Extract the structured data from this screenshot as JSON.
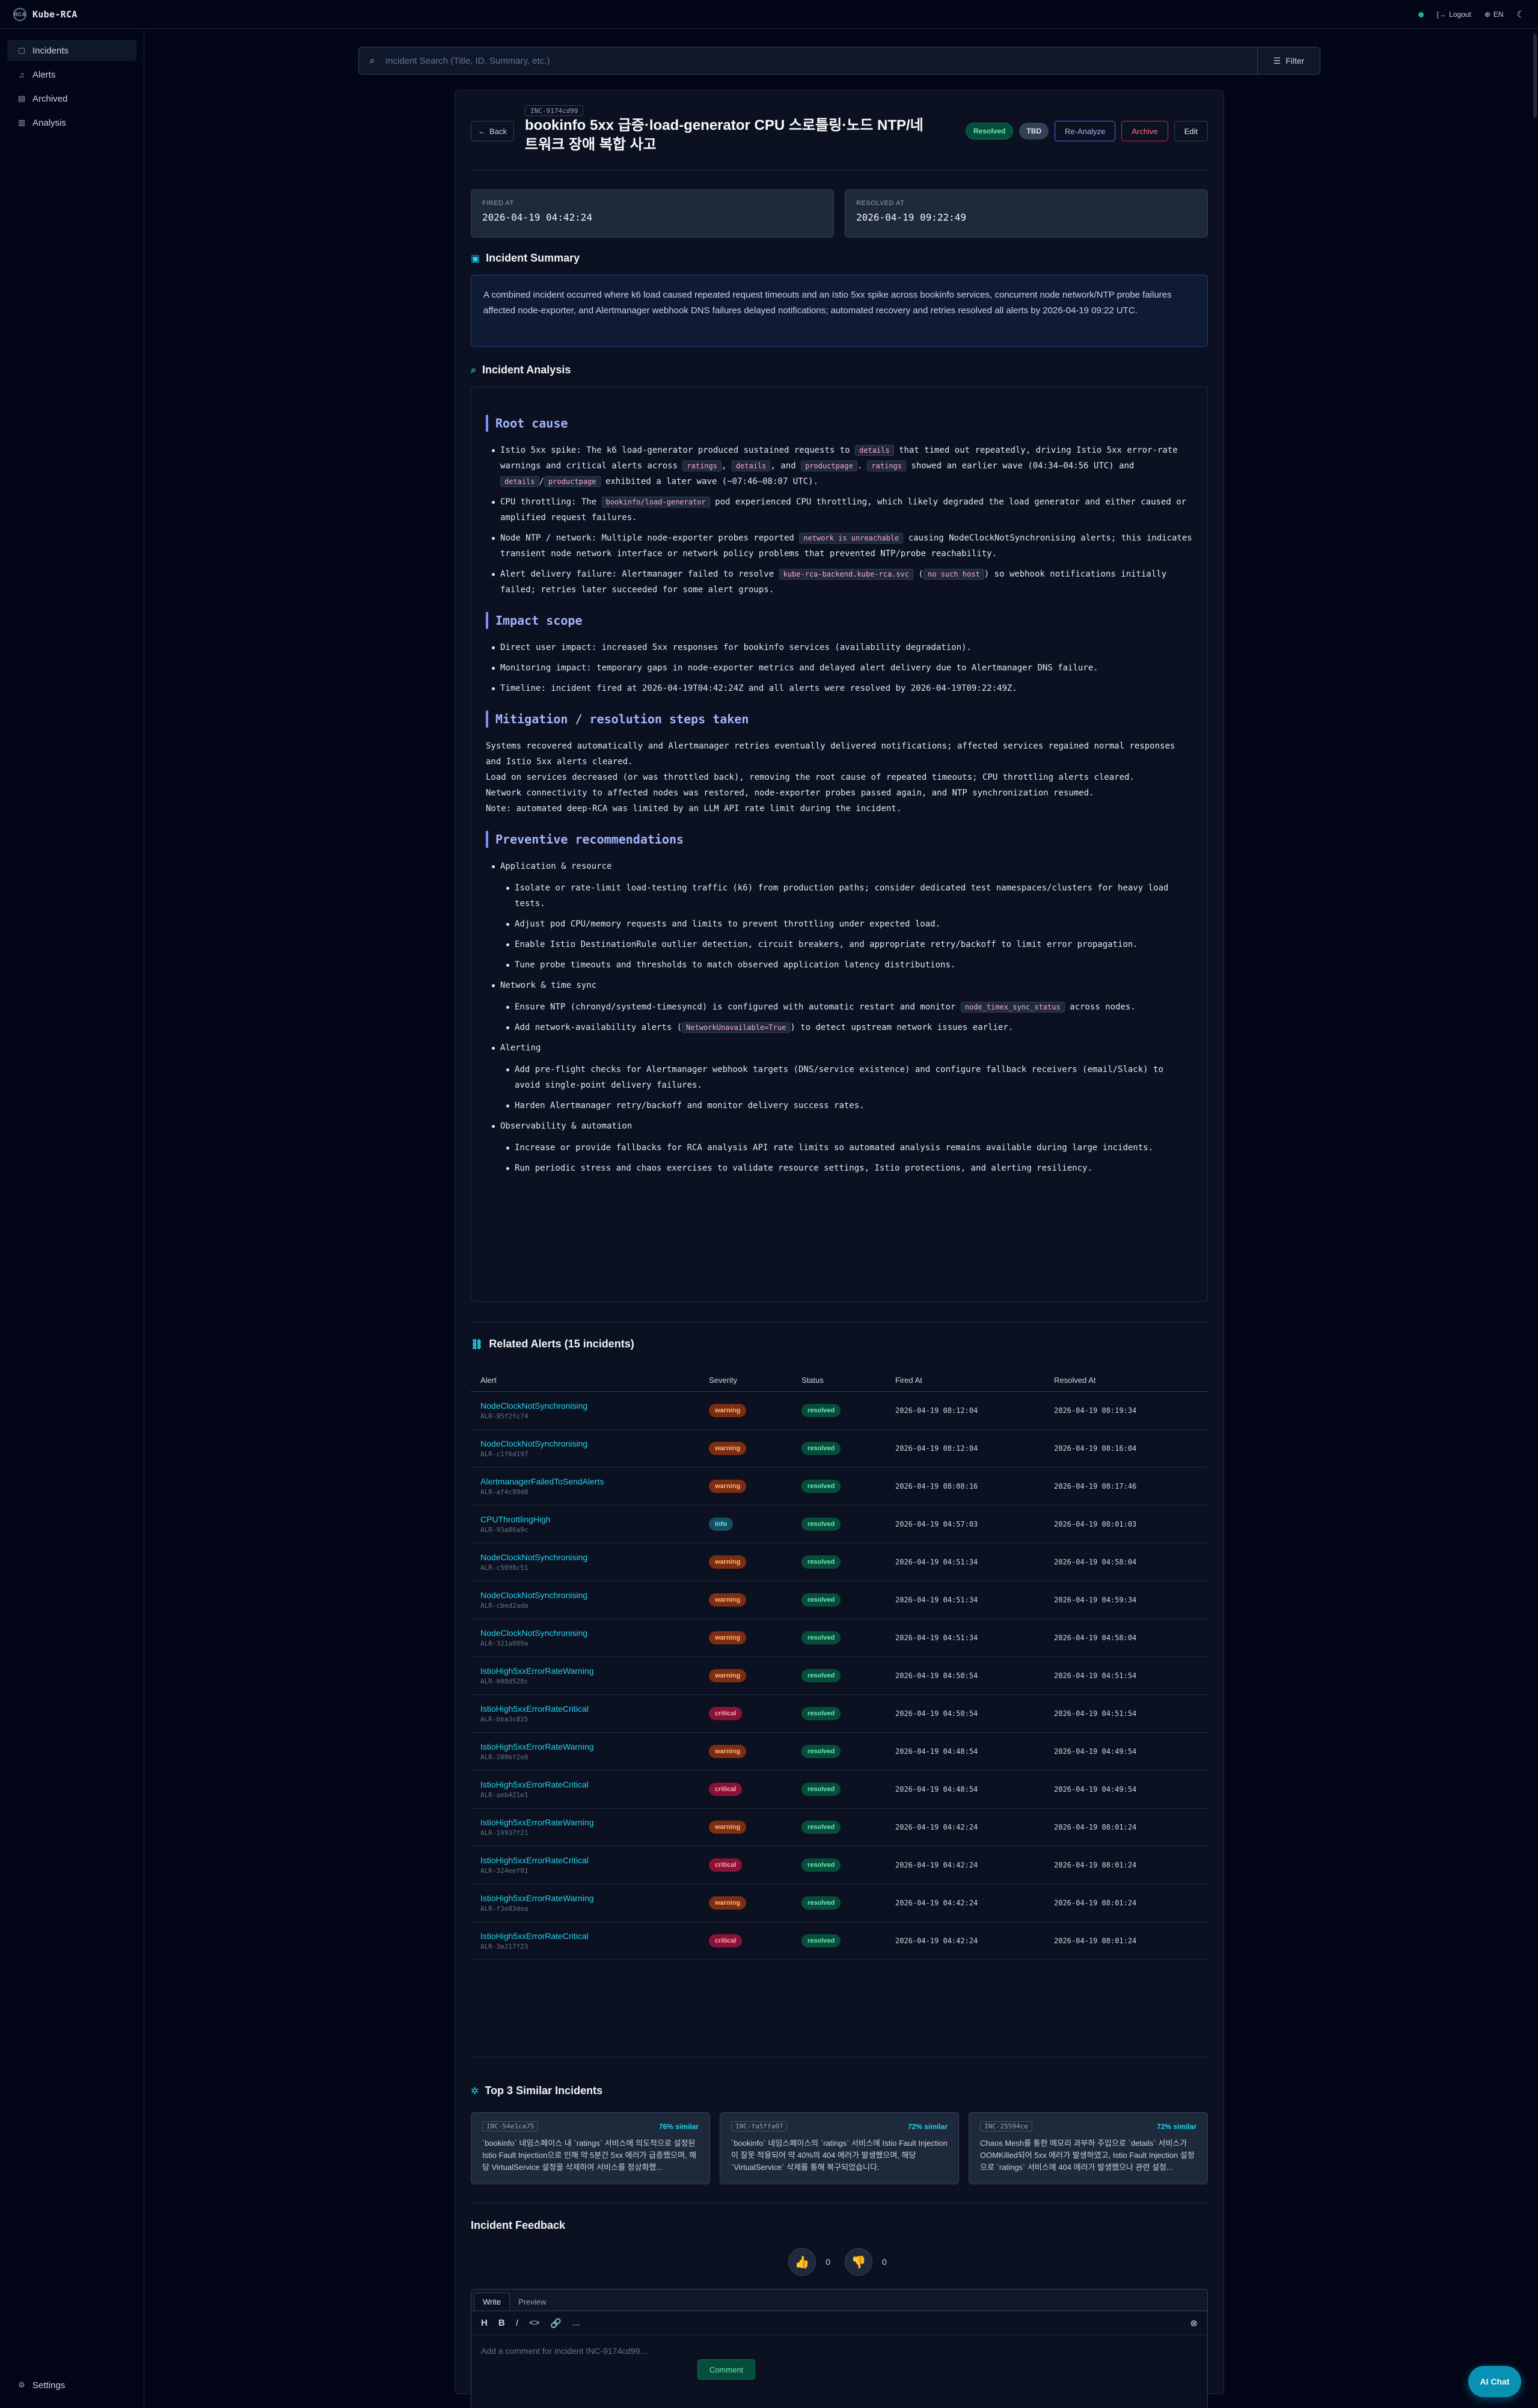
{
  "app": {
    "name": "Kube-RCA",
    "logo_text": "RCA"
  },
  "topbar": {
    "logout": "Logout",
    "lang": "EN"
  },
  "sidebar": {
    "items": [
      {
        "label": "Incidents",
        "icon": "incidents-icon"
      },
      {
        "label": "Alerts",
        "icon": "bell-icon"
      },
      {
        "label": "Archived",
        "icon": "archive-icon"
      },
      {
        "label": "Analysis",
        "icon": "chart-icon"
      }
    ],
    "settings": "Settings"
  },
  "search": {
    "placeholder": "Incident Search (Title, ID, Summary, etc.)",
    "filter_label": "Filter"
  },
  "incident": {
    "id": "INC-9174cd99",
    "back": "Back",
    "title": "bookinfo 5xx 급증·load-generator CPU 스로틀링·노드 NTP/네트워크 장애 복합 사고",
    "status": "Resolved",
    "tag": "TBD",
    "actions": {
      "reanalyze": "Re-Analyze",
      "archive": "Archive",
      "edit": "Edit"
    },
    "fired_label": "FIRED AT",
    "fired_at": "2026-04-19 04:42:24",
    "resolved_label": "RESOLVED AT",
    "resolved_at": "2026-04-19 09:22:49"
  },
  "summary": {
    "heading": "Incident Summary",
    "text": "A combined incident occurred where k6 load caused repeated request timeouts and an Istio 5xx spike across bookinfo services, concurrent node network/NTP probe failures affected node-exporter, and Alertmanager webhook DNS failures delayed notifications; automated recovery and retries resolved all alerts by 2026-04-19 09:22 UTC."
  },
  "analysis": {
    "heading": "Incident Analysis",
    "root_cause": {
      "title": "Root cause",
      "i1": {
        "a": "Istio 5xx spike: The k6 load-generator produced sustained requests to",
        "c1": "details",
        "b": "that timed out repeatedly, driving Istio 5xx error-rate warnings and critical alerts across",
        "c2": "ratings",
        "s1": ",",
        "c3": "details",
        "s2": ", and",
        "c4": "productpage",
        "s3": ".",
        "c5": "ratings",
        "d": "showed an earlier wave (04:34–04:56 UTC) and",
        "c6": "details",
        "s4": "/",
        "c7": "productpage",
        "e": "exhibited a later wave (~07:46–08:07 UTC)."
      },
      "i2": {
        "a": "CPU throttling: The",
        "c1": "bookinfo/load-generator",
        "b": "pod experienced CPU throttling, which likely degraded the load generator and either caused or amplified request failures."
      },
      "i3": {
        "a": "Node NTP / network: Multiple node-exporter probes reported",
        "c1": "network is unreachable",
        "b": "causing NodeClockNotSynchronising alerts; this indicates transient node network interface or network policy problems that prevented NTP/probe reachability."
      },
      "i4": {
        "a": "Alert delivery failure: Alertmanager failed to resolve",
        "c1": "kube-rca-backend.kube-rca.svc",
        "s1": "(",
        "c2": "no such host",
        "b": ") so webhook notifications initially failed; retries later succeeded for some alert groups."
      }
    },
    "impact": {
      "title": "Impact scope",
      "items": [
        "Direct user impact: increased 5xx responses for bookinfo services (availability degradation).",
        "Monitoring impact: temporary gaps in node-exporter metrics and delayed alert delivery due to Alertmanager DNS failure.",
        "Timeline: incident fired at 2026-04-19T04:42:24Z and all alerts were resolved by 2026-04-19T09:22:49Z."
      ]
    },
    "mitigation": {
      "title": "Mitigation / resolution steps taken",
      "lines": [
        "Systems recovered automatically and Alertmanager retries eventually delivered notifications; affected services regained normal responses and Istio 5xx alerts cleared.",
        "Load on services decreased (or was throttled back), removing the root cause of repeated timeouts; CPU throttling alerts cleared.",
        "Network connectivity to affected nodes was restored, node-exporter probes passed again, and NTP synchronization resumed.",
        "Note: automated deep-RCA was limited by an LLM API rate limit during the incident."
      ]
    },
    "preventive": {
      "title": "Preventive recommendations",
      "app": {
        "title": "Application & resource",
        "items": [
          "Isolate or rate-limit load-testing traffic (k6) from production paths; consider dedicated test namespaces/clusters for heavy load tests.",
          "Adjust pod CPU/memory requests and limits to prevent throttling under expected load.",
          "Enable Istio DestinationRule outlier detection, circuit breakers, and appropriate retry/backoff to limit error propagation.",
          "Tune probe timeouts and thresholds to match observed application latency distributions."
        ]
      },
      "net": {
        "title": "Network & time sync",
        "n1": {
          "a": "Ensure NTP (chronyd/systemd-timesyncd) is configured with automatic restart and monitor",
          "c1": "node_timex_sync_status",
          "b": "across nodes."
        },
        "n2": {
          "a": "Add network-availability alerts (",
          "c1": "NetworkUnavailable=True",
          "b": ") to detect upstream network issues earlier."
        }
      },
      "alerting": {
        "title": "Alerting",
        "items": [
          "Add pre-flight checks for Alertmanager webhook targets (DNS/service existence) and configure fallback receivers (email/Slack) to avoid single-point delivery failures.",
          "Harden Alertmanager retry/backoff and monitor delivery success rates."
        ]
      },
      "obs": {
        "title": "Observability & automation",
        "items": [
          "Increase or provide fallbacks for RCA analysis API rate limits so automated analysis remains available during large incidents.",
          "Run periodic stress and chaos exercises to validate resource settings, Istio protections, and alerting resiliency."
        ]
      }
    }
  },
  "related": {
    "heading": "Related Alerts (15 incidents)",
    "columns": [
      "Alert",
      "Severity",
      "Status",
      "Fired At",
      "Resolved At"
    ],
    "rows": [
      {
        "name": "NodeClockNotSynchronising",
        "id": "ALR-95f2fc74",
        "severity": "warning",
        "status": "resolved",
        "fired": "2026-04-19 08:12:04",
        "resolved": "2026-04-19 08:19:34"
      },
      {
        "name": "NodeClockNotSynchronising",
        "id": "ALR-c1f6d197",
        "severity": "warning",
        "status": "resolved",
        "fired": "2026-04-19 08:12:04",
        "resolved": "2026-04-19 08:16:04"
      },
      {
        "name": "AlertmanagerFailedToSendAlerts",
        "id": "ALR-af4c89d8",
        "severity": "warning",
        "status": "resolved",
        "fired": "2026-04-19 08:08:16",
        "resolved": "2026-04-19 08:17:46"
      },
      {
        "name": "CPUThrottlingHigh",
        "id": "ALR-93a86a9c",
        "severity": "info",
        "status": "resolved",
        "fired": "2026-04-19 04:57:03",
        "resolved": "2026-04-19 08:01:03"
      },
      {
        "name": "NodeClockNotSynchronising",
        "id": "ALR-c5098c51",
        "severity": "warning",
        "status": "resolved",
        "fired": "2026-04-19 04:51:34",
        "resolved": "2026-04-19 04:58:04"
      },
      {
        "name": "NodeClockNotSynchronising",
        "id": "ALR-cbed2ada",
        "severity": "warning",
        "status": "resolved",
        "fired": "2026-04-19 04:51:34",
        "resolved": "2026-04-19 04:59:34"
      },
      {
        "name": "NodeClockNotSynchronising",
        "id": "ALR-321a809a",
        "severity": "warning",
        "status": "resolved",
        "fired": "2026-04-19 04:51:34",
        "resolved": "2026-04-19 04:58:04"
      },
      {
        "name": "IstioHigh5xxErrorRateWarning",
        "id": "ALR-608d528c",
        "severity": "warning",
        "status": "resolved",
        "fired": "2026-04-19 04:50:54",
        "resolved": "2026-04-19 04:51:54"
      },
      {
        "name": "IstioHigh5xxErrorRateCritical",
        "id": "ALR-bba3c825",
        "severity": "critical",
        "status": "resolved",
        "fired": "2026-04-19 04:50:54",
        "resolved": "2026-04-19 04:51:54"
      },
      {
        "name": "IstioHigh5xxErrorRateWarning",
        "id": "ALR-280bf2e8",
        "severity": "warning",
        "status": "resolved",
        "fired": "2026-04-19 04:48:54",
        "resolved": "2026-04-19 04:49:54"
      },
      {
        "name": "IstioHigh5xxErrorRateCritical",
        "id": "ALR-aeb421e1",
        "severity": "critical",
        "status": "resolved",
        "fired": "2026-04-19 04:48:54",
        "resolved": "2026-04-19 04:49:54"
      },
      {
        "name": "IstioHigh5xxErrorRateWarning",
        "id": "ALR-19937f21",
        "severity": "warning",
        "status": "resolved",
        "fired": "2026-04-19 04:42:24",
        "resolved": "2026-04-19 08:01:24"
      },
      {
        "name": "IstioHigh5xxErrorRateCritical",
        "id": "ALR-324eef01",
        "severity": "critical",
        "status": "resolved",
        "fired": "2026-04-19 04:42:24",
        "resolved": "2026-04-19 08:01:24"
      },
      {
        "name": "IstioHigh5xxErrorRateWarning",
        "id": "ALR-f3e83dea",
        "severity": "warning",
        "status": "resolved",
        "fired": "2026-04-19 04:42:24",
        "resolved": "2026-04-19 08:01:24"
      },
      {
        "name": "IstioHigh5xxErrorRateCritical",
        "id": "ALR-3e217f23",
        "severity": "critical",
        "status": "resolved",
        "fired": "2026-04-19 04:42:24",
        "resolved": "2026-04-19 08:01:24"
      }
    ]
  },
  "similar": {
    "heading": "Top 3 Similar Incidents",
    "items": [
      {
        "id": "INC-54e1ca75",
        "pct": "76% similar",
        "text": "`bookinfo` 네임스페이스 내 `ratings` 서비스에 의도적으로 설정된 Istio Fault Injection으로 인해 약 5분간 5xx 에러가 급증했으며, 해당 VirtualService 설정을 삭제하여 서비스를 정상화했..."
      },
      {
        "id": "INC-fa5ffa07",
        "pct": "72% similar",
        "text": "`bookinfo` 네임스페이스의 `ratings` 서비스에 Istio Fault Injection이 잘못 적용되어 약 40%의 404 에러가 발생했으며, 해당 `VirtualService` 삭제를 통해 복구되었습니다."
      },
      {
        "id": "INC-25594ce",
        "pct": "72% similar",
        "text": "Chaos Mesh를 통한 메모리 과부하 주입으로 `details` 서비스가 OOMKilled되어 5xx 에러가 발생하였고, Istio Fault Injection 설정으로 `ratings` 서비스에 404 에러가 발생했으나 관련 설정..."
      }
    ]
  },
  "feedback": {
    "heading": "Incident Feedback",
    "up": "0",
    "down": "0",
    "tabs": [
      "Write",
      "Preview"
    ],
    "toolbar": [
      "H",
      "B",
      "I",
      "<>",
      "🔗",
      "..."
    ],
    "placeholder": "Add a comment for incident INC-9174cd99...",
    "comment_btn": "Comment"
  },
  "ai_chat": "AI Chat",
  "colors": {
    "accent": "#22d3ee",
    "success": "#10b981",
    "warning": "#ea580c",
    "critical": "#e11d48",
    "indigo": "#818cf8"
  }
}
